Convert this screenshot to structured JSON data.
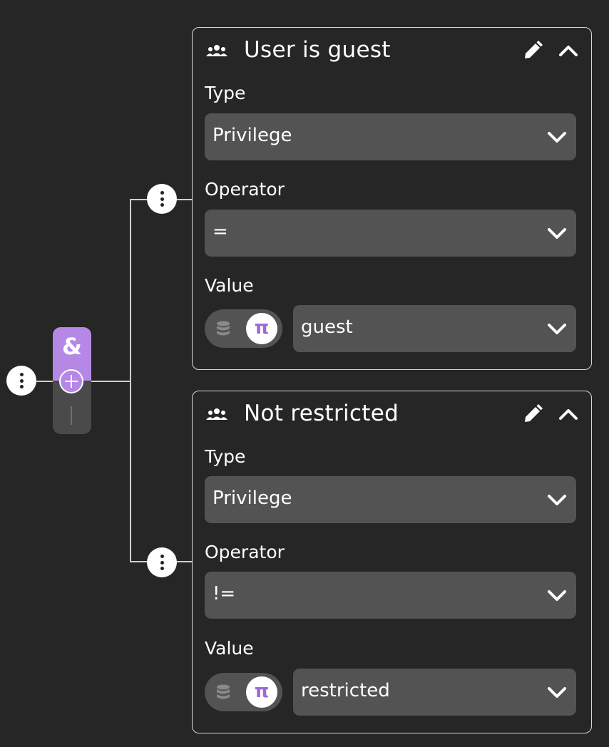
{
  "group": {
    "operator_symbol": "&"
  },
  "conditions": [
    {
      "title": "User is guest",
      "type_label": "Type",
      "type_value": "Privilege",
      "operator_label": "Operator",
      "operator_value": "=",
      "value_label": "Value",
      "value_toggle_symbol": "π",
      "value_value": "guest"
    },
    {
      "title": "Not restricted",
      "type_label": "Type",
      "type_value": "Privilege",
      "operator_label": "Operator",
      "operator_value": "!=",
      "value_label": "Value",
      "value_toggle_symbol": "π",
      "value_value": "restricted"
    }
  ],
  "colors": {
    "background": "#262626",
    "accent": "#b688e6",
    "field_bg": "#535353",
    "border": "#d8d8d8"
  }
}
